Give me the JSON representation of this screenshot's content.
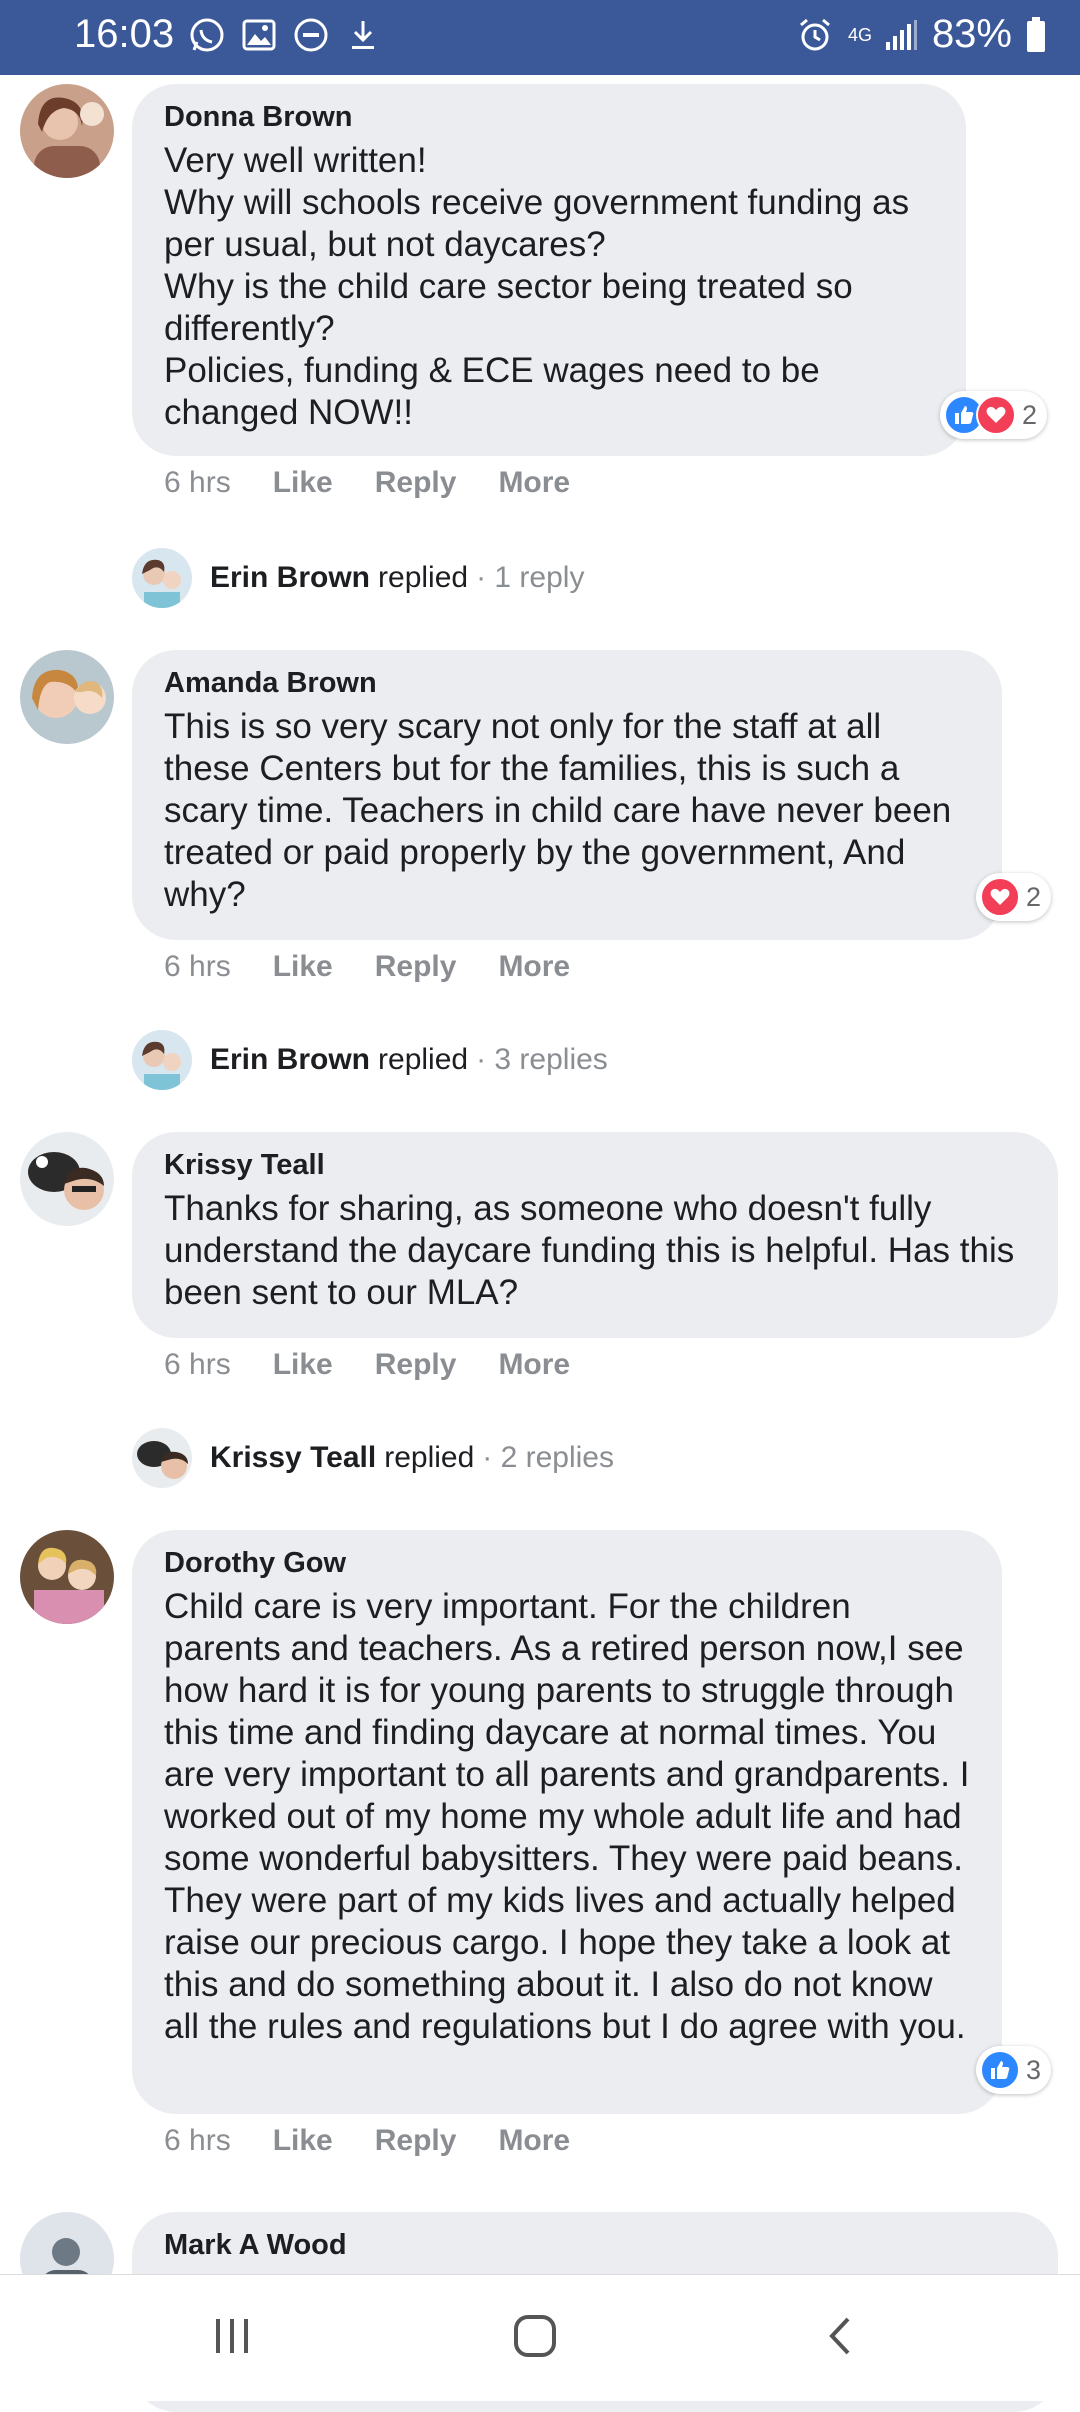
{
  "status_bar": {
    "time": "16:03",
    "network": "4G",
    "battery": "83%",
    "left_icons": [
      "whatsapp-icon",
      "gallery-icon",
      "do-not-disturb-icon",
      "download-icon"
    ],
    "right_icons": [
      "alarm-icon",
      "signal-icon",
      "battery-icon"
    ],
    "background": "#3b5998"
  },
  "comments": [
    {
      "author": "Donna Brown",
      "text": "Very well written!\nWhy will schools receive government funding as per usual, but not daycares?\nWhy is the child care sector being treated so differently?\nPolicies, funding & ECE wages need to be changed NOW!!",
      "time": "6 hrs",
      "reactions": [
        "like",
        "love"
      ],
      "reaction_count": "2",
      "reply_summary": {
        "name": "Erin Brown",
        "verb": "replied",
        "count": "· 1 reply"
      }
    },
    {
      "author": "Amanda Brown",
      "text": "This is so very scary not only for the staff at all these Centers but for the families, this is such a scary time. Teachers in child care have never been treated or paid properly by the government, And why?",
      "time": "6 hrs",
      "reactions": [
        "love"
      ],
      "reaction_count": "2",
      "reply_summary": {
        "name": "Erin Brown",
        "verb": "replied",
        "count": "· 3 replies"
      }
    },
    {
      "author": "Krissy Teall",
      "text": "Thanks for sharing, as someone who doesn't fully understand the daycare funding this is helpful. Has this been sent to our MLA?",
      "time": "6 hrs",
      "reactions": [],
      "reaction_count": "",
      "reply_summary": {
        "name": "Krissy Teall",
        "verb": "replied",
        "count": "· 2 replies"
      }
    },
    {
      "author": "Dorothy Gow",
      "text": "Child care is very important. For the children parents and teachers. As a retired person now,I see how hard it is for young parents to struggle through this time and finding daycare at normal times. You are very important to all parents and grandparents. I worked out of my home my whole adult life and had some wonderful babysitters. They were paid beans. They were part of my kids lives and actually helped raise our precious cargo. I hope they take a look at this and do something about it. I also do not know all the rules and regulations but I do agree with you.",
      "time": "6 hrs",
      "reactions": [
        "like"
      ],
      "reaction_count": "3"
    },
    {
      "author": "Mark A Wood"
    }
  ],
  "actions": {
    "like": "Like",
    "reply": "Reply",
    "more": "More"
  },
  "nav_bar": {
    "buttons": [
      "recent-apps-icon",
      "home-icon",
      "back-icon"
    ]
  },
  "colors": {
    "bubble": "#ebedf0",
    "like": "#2d88ff",
    "love": "#f33e58",
    "meta_text": "#8a8d91"
  }
}
